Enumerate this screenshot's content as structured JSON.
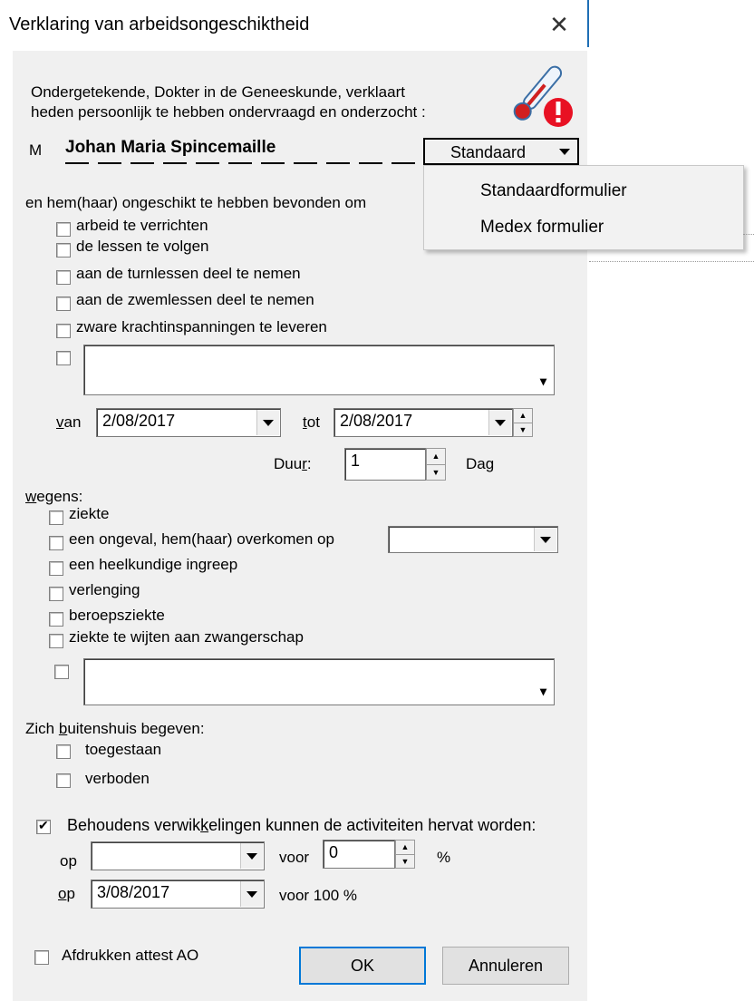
{
  "window": {
    "title": "Verklaring van arbeidsongeschiktheid"
  },
  "intro": {
    "line1": "Ondergetekende, Dokter in de Geneeskunde, verklaart",
    "line2": "heden persoonlijk te hebben ondervraagd en onderzocht :",
    "prefix": "M",
    "patient_name": "Johan Maria Spincemaille"
  },
  "form_type": {
    "selected": "Standaard",
    "options": [
      "Standaardformulier",
      "Medex formulier"
    ]
  },
  "unfit": {
    "heading": "en hem(haar) ongeschikt te hebben bevonden om",
    "items": [
      "arbeid te verrichten",
      "de lessen te volgen",
      "aan de turnlessen deel te nemen",
      "aan de zwemlessen deel te nemen",
      "zware krachtinspanningen te leveren"
    ]
  },
  "period": {
    "from_label": "van",
    "from_value": "2/08/2017",
    "to_label": "tot",
    "to_value": "2/08/2017",
    "duration_label": "Duur:",
    "duration_value": "1",
    "duration_unit": "Dag"
  },
  "reason": {
    "heading": "wegens:",
    "items": [
      "ziekte",
      "een ongeval, hem(haar) overkomen op",
      "een heelkundige ingreep",
      "verlenging",
      "beroepsziekte",
      "ziekte te wijten aan zwangerschap"
    ]
  },
  "outside": {
    "heading": "Zich buitenshuis begeven:",
    "items": [
      "toegestaan",
      "verboden"
    ]
  },
  "resume": {
    "label": "Behoudens verwikkelingen kunnen de activiteiten hervat worden:",
    "checked": true,
    "row1_op": "op",
    "row1_date": "",
    "row1_voor": "voor",
    "row1_percent": "0",
    "row1_unit": "%",
    "row2_op": "op",
    "row2_date": "3/08/2017",
    "row2_voor": "voor 100 %"
  },
  "footer": {
    "print_label": "Afdrukken attest AO",
    "ok_label": "OK",
    "cancel_label": "Annuleren"
  },
  "colors": {
    "accent": "#0078d7",
    "dialog_bg": "#f0f0f0",
    "alert_red": "#e81123"
  }
}
